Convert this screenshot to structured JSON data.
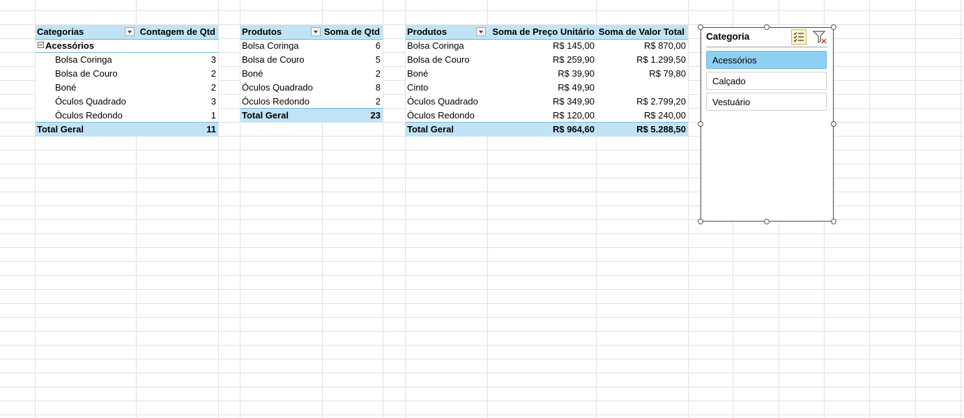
{
  "pivot1": {
    "header": [
      "Categorias",
      "Contagem de Qtd"
    ],
    "group": "Acessórios",
    "rows": [
      [
        "Bolsa Coringa",
        "3"
      ],
      [
        "Bolsa de Couro",
        "2"
      ],
      [
        "Boné",
        "2"
      ],
      [
        "Óculos Quadrado",
        "3"
      ],
      [
        "Óculos Redondo",
        "1"
      ]
    ],
    "total": [
      "Total Geral",
      "11"
    ]
  },
  "pivot2": {
    "header": [
      "Produtos",
      "Soma de Qtd"
    ],
    "rows": [
      [
        "Bolsa Coringa",
        "6"
      ],
      [
        "Bolsa de Couro",
        "5"
      ],
      [
        "Boné",
        "2"
      ],
      [
        "Óculos Quadrado",
        "8"
      ],
      [
        "Óculos Redondo",
        "2"
      ]
    ],
    "total": [
      "Total Geral",
      "23"
    ]
  },
  "pivot3": {
    "header": [
      "Produtos",
      "Soma de Preço Unitário",
      "Soma de Valor Total"
    ],
    "rows": [
      [
        "Bolsa Coringa",
        "R$ 145,00",
        "R$ 870,00"
      ],
      [
        "Bolsa de Couro",
        "R$ 259,90",
        "R$ 1.299,50"
      ],
      [
        "Boné",
        "R$ 39,90",
        "R$ 79,80"
      ],
      [
        "Cinto",
        "R$ 49,90",
        ""
      ],
      [
        "Óculos Quadrado",
        "R$ 349,90",
        "R$ 2.799,20"
      ],
      [
        "Óculos Redondo",
        "R$ 120,00",
        "R$ 240,00"
      ]
    ],
    "total": [
      "Total Geral",
      "R$ 964,60",
      "R$ 5.288,50"
    ]
  },
  "slicer": {
    "title": "Categoria",
    "items": [
      {
        "label": "Acessórios",
        "selected": true
      },
      {
        "label": "Calçado",
        "selected": false
      },
      {
        "label": "Vestuário",
        "selected": false
      }
    ],
    "multiselect_icon": "multi-select-icon",
    "clear_icon": "clear-filter-icon"
  },
  "colors": {
    "header_fill": "#c0e4f5",
    "slicer_selected": "#8fd0f2",
    "grid": "#e1e1e1"
  }
}
